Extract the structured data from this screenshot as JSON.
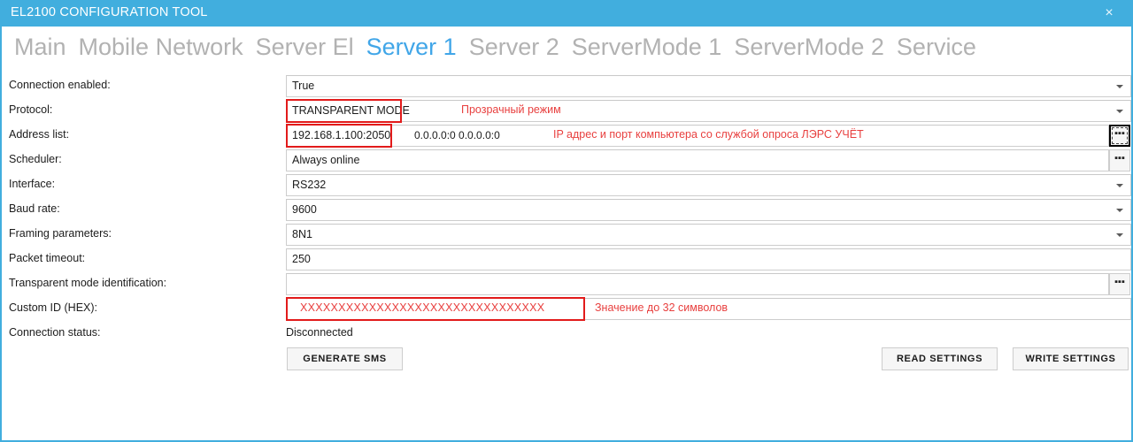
{
  "window": {
    "title": "EL2100 CONFIGURATION TOOL",
    "close_icon": "×",
    "accent_color": "#41aede"
  },
  "tabs": [
    {
      "label": "Main",
      "active": false
    },
    {
      "label": "Mobile Network",
      "active": false
    },
    {
      "label": "Server El",
      "active": false
    },
    {
      "label": "Server 1",
      "active": true
    },
    {
      "label": "Server 2",
      "active": false
    },
    {
      "label": "ServerMode 1",
      "active": false
    },
    {
      "label": "ServerMode 2",
      "active": false
    },
    {
      "label": "Service",
      "active": false
    }
  ],
  "form": {
    "rows": [
      {
        "label": "Connection enabled:",
        "value": "True"
      },
      {
        "label": "Protocol:",
        "value": "TRANSPARENT MODE"
      },
      {
        "label": "Address list:",
        "value": "192.168.1.100:2050"
      },
      {
        "label": "Scheduler:",
        "value": "Always online"
      },
      {
        "label": "Interface:",
        "value": "RS232"
      },
      {
        "label": "Baud rate:",
        "value": "9600"
      },
      {
        "label": "Framing parameters:",
        "value": "8N1"
      },
      {
        "label": "Packet timeout:",
        "value": "250"
      },
      {
        "label": "Transparent mode identification:",
        "value": ""
      },
      {
        "label": "Custom ID (HEX):",
        "value": "XXXXXXXXXXXXXXXXXXXXXXXXXXXXXXXX"
      },
      {
        "label": "Connection status:",
        "value": "Disconnected"
      }
    ],
    "address_extra": "0.0.0.0:0  0.0.0.0:0",
    "dots_label": "▪▪▪"
  },
  "annotations": {
    "protocol_note": "Прозрачный режим",
    "address_note": "IP адрес и порт компьютера со службой опроса ЛЭРС УЧЁТ",
    "custom_id_note": "Значение до 32 символов",
    "highlight_color": "#e21b1b",
    "note_color": "#e8403f"
  },
  "buttons": {
    "generate_sms": "GENERATE SMS",
    "read_settings": "READ SETTINGS",
    "write_settings": "WRITE SETTINGS"
  }
}
